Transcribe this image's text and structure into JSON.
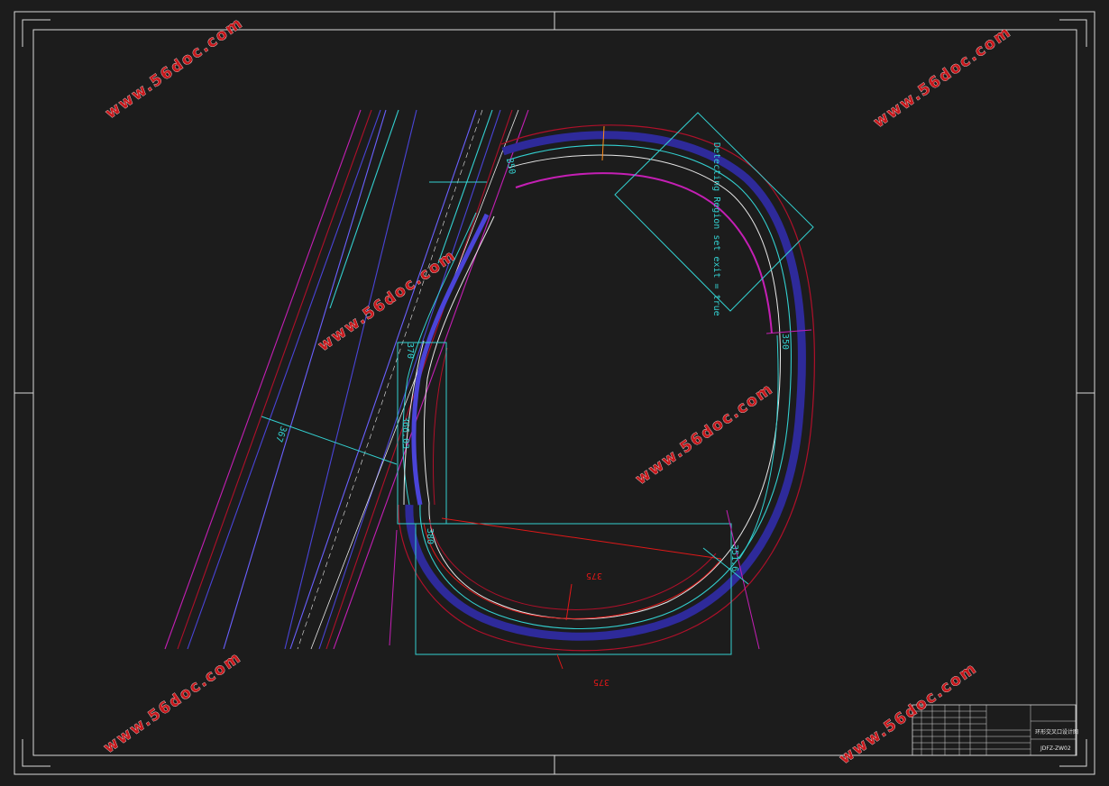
{
  "drawing": {
    "annotation_text": "Detecting Region set exit = true",
    "dimensions": {
      "left_offset": "367",
      "entry_width": "370",
      "entry_radius": "366.03",
      "exit_label": "380",
      "top_label": "350",
      "right_label": "350",
      "lower_right_label": "351.6",
      "inner_span": "375",
      "outer_span": "375"
    }
  },
  "watermark": {
    "text": "www.56doc.com"
  },
  "title_block": {
    "title": "环形交叉口设计图",
    "drawing_no": "JDFZ-ZW02"
  },
  "colors": {
    "background": "#1c1c1c",
    "frame": "#d8d8d8",
    "road_blue": "#4a44d8",
    "road_cyan": "#33d0d0",
    "road_magenta": "#c41fb4",
    "road_red": "#b0102a",
    "centerline": "#e8e8e8",
    "dimension_red": "#e01818",
    "watermark": "#c8181c"
  }
}
